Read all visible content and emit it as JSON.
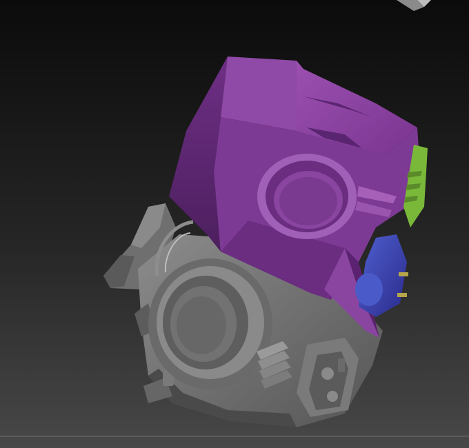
{
  "viewport": {
    "background_top": "#0d0d0d",
    "background_bottom": "#444444"
  },
  "colors": {
    "helmet_purple": "#8a3f9e",
    "helmet_purple_light": "#a660b8",
    "helmet_purple_dark": "#5c2670",
    "mech_gray": "#7a7a7a",
    "mech_gray_light": "#9a9a9a",
    "mech_gray_dark": "#4e4e4e",
    "accent_green": "#7ab83a",
    "accent_blue": "#3a3aa8",
    "accent_blue_light": "#5a6ad8",
    "accent_yellow": "#b5a54a"
  },
  "model": {
    "parts": [
      "helmet-shell",
      "eye-socket-ring",
      "brow-ridge",
      "side-fin-green",
      "side-module-blue",
      "mechanical-jaw",
      "lens-housing",
      "cooling-fins",
      "cable-loop",
      "mount-bracket"
    ]
  }
}
